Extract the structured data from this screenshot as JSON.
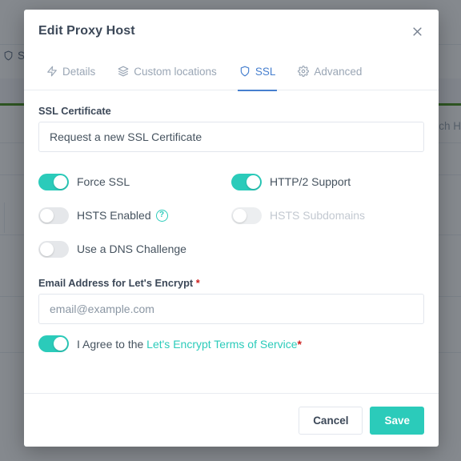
{
  "background": {
    "ssl_tab_label": "SSL",
    "search_placeholder": "Search H",
    "accent_green": "#3f8c10",
    "row_line_tops": [
      98,
      129,
      178,
      218,
      293,
      370,
      440
    ]
  },
  "modal": {
    "title": "Edit Proxy Host",
    "close_label": "×",
    "tabs": [
      {
        "label": "Details",
        "icon": "zap-icon",
        "active": false
      },
      {
        "label": "Custom locations",
        "icon": "layers-icon",
        "active": false
      },
      {
        "label": "SSL",
        "icon": "shield-icon",
        "active": true
      },
      {
        "label": "Advanced",
        "icon": "gear-icon",
        "active": false
      }
    ],
    "ssl_certificate": {
      "label": "SSL Certificate",
      "value": "Request a new SSL Certificate"
    },
    "toggles": [
      {
        "label": "Force SSL",
        "on": true,
        "disabled": false,
        "help": false
      },
      {
        "label": "HTTP/2 Support",
        "on": true,
        "disabled": false,
        "help": false
      },
      {
        "label": "HSTS Enabled",
        "on": false,
        "disabled": false,
        "help": true,
        "help_glyph": "?"
      },
      {
        "label": "HSTS Subdomains",
        "on": false,
        "disabled": true,
        "help": false
      },
      {
        "label": "Use a DNS Challenge",
        "on": false,
        "disabled": false,
        "help": false
      }
    ],
    "email": {
      "label": "Email Address for Let's Encrypt",
      "required_mark": "*",
      "placeholder": "email@example.com",
      "value": "email@example.com"
    },
    "agreement": {
      "on": true,
      "prefix": "I Agree to the ",
      "link_text": "Let's Encrypt Terms of Service",
      "required_mark": "*"
    },
    "footer": {
      "cancel_label": "Cancel",
      "save_label": "Save"
    }
  },
  "colors": {
    "teal": "#2bcbba",
    "active_tab_blue": "#467fcf",
    "required_red": "#cd201f",
    "heading": "#3c4858",
    "muted": "#9aa6b5"
  }
}
